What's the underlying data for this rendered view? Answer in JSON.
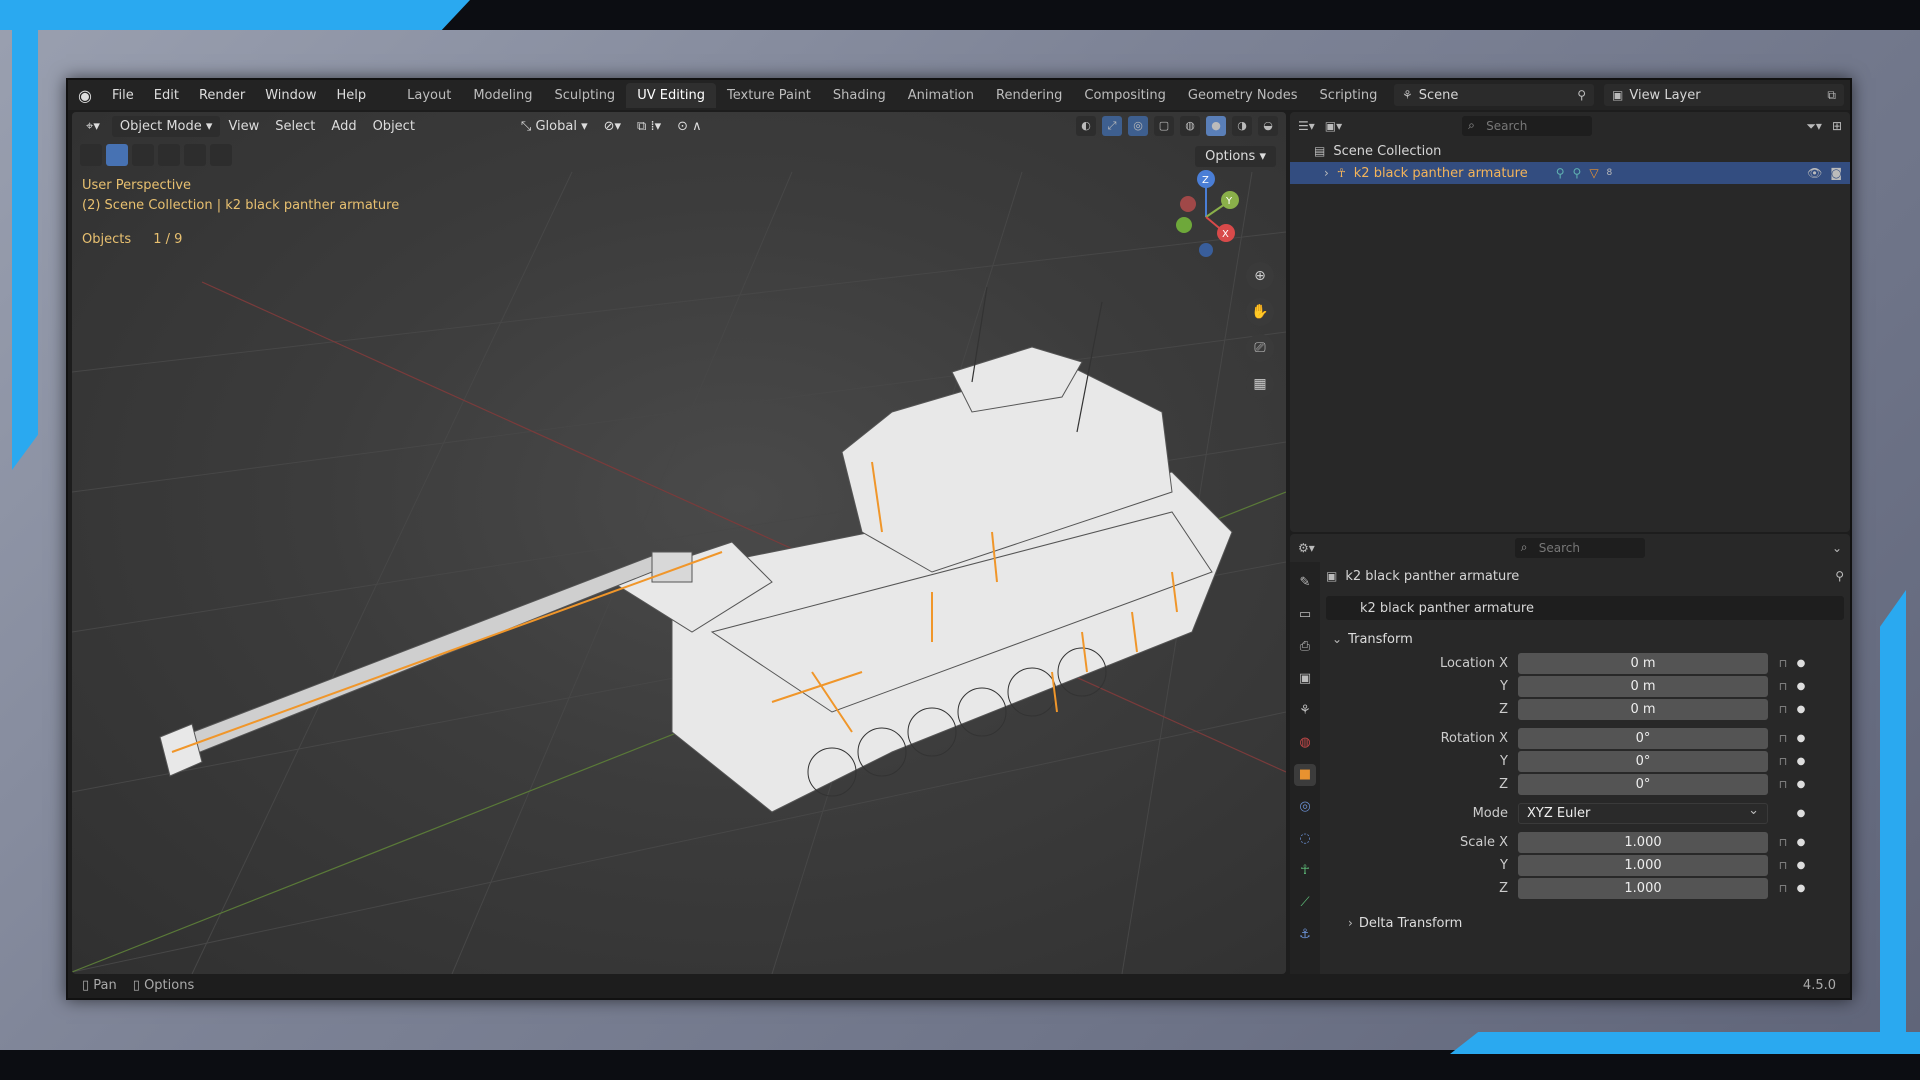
{
  "menu": {
    "items": [
      "File",
      "Edit",
      "Render",
      "Window",
      "Help"
    ]
  },
  "workspaces": {
    "tabs": [
      "Layout",
      "Modeling",
      "Sculpting",
      "UV Editing",
      "Texture Paint",
      "Shading",
      "Animation",
      "Rendering",
      "Compositing",
      "Geometry Nodes",
      "Scripting"
    ],
    "active": "UV Editing"
  },
  "scene": {
    "name": "Scene",
    "view_layer": "View Layer"
  },
  "viewport": {
    "mode": "Object Mode",
    "menus": [
      "View",
      "Select",
      "Add",
      "Object"
    ],
    "orientation": "Global",
    "options_label": "Options",
    "overlay_perspective": "User Perspective",
    "overlay_collection": "(2) Scene Collection | k2 black panther armature",
    "objects_label": "Objects",
    "objects_count": "1 / 9"
  },
  "outliner": {
    "search_placeholder": "Search",
    "root": "Scene Collection",
    "item": "k2 black panther armature",
    "item_count": "8"
  },
  "properties": {
    "search_placeholder": "Search",
    "object_title": "k2 black panther armature",
    "object_field": "k2 black panther armature",
    "transform_title": "Transform",
    "location_label": "Location X",
    "rotation_label": "Rotation X",
    "scale_label": "Scale X",
    "y_label": "Y",
    "z_label": "Z",
    "mode_label": "Mode",
    "location": [
      "0 m",
      "0 m",
      "0 m"
    ],
    "rotation": [
      "0°",
      "0°",
      "0°"
    ],
    "mode": "XYZ Euler",
    "scale": [
      "1.000",
      "1.000",
      "1.000"
    ],
    "delta_title": "Delta Transform"
  },
  "status": {
    "pan": "Pan",
    "options": "Options",
    "version": "4.5.0"
  },
  "colors": {
    "accent_frame": "#2aa9f0",
    "selection": "#334d80",
    "armature": "#f3b45a"
  }
}
